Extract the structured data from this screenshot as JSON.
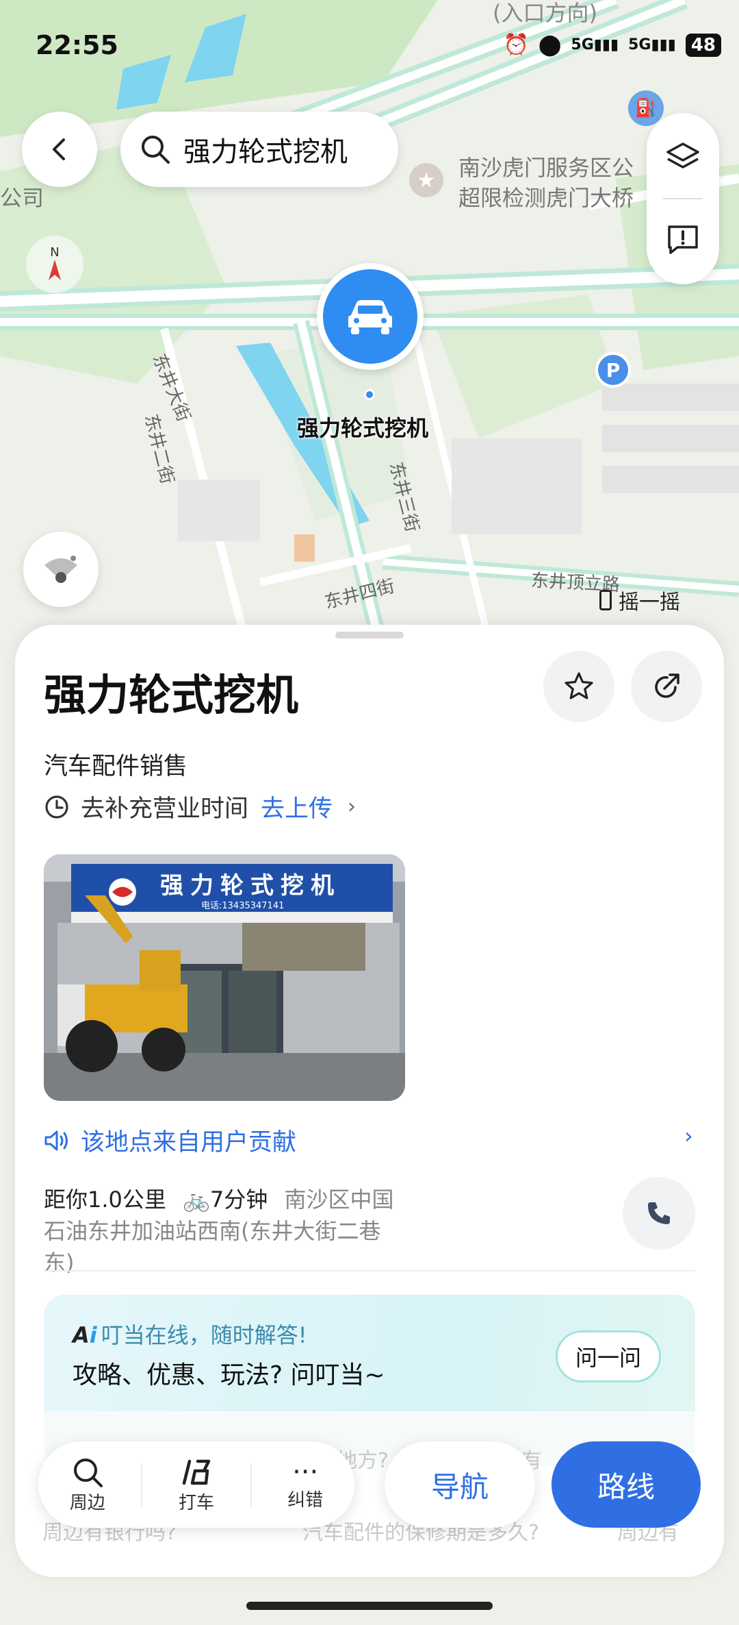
{
  "status_bar": {
    "time": "22:55",
    "battery": "48",
    "signal_1": "5G",
    "signal_2": "5G"
  },
  "search": {
    "query": "强力轮式挖机"
  },
  "map": {
    "labels": {
      "top_entrance": "(入口方向)",
      "service_area_line1": "南沙虎门服务区公",
      "service_area_line2": "超限检测虎门大桥",
      "company": "公司",
      "compass": "N",
      "poi_label": "强力轮式挖机",
      "parking": "P",
      "street_1": "东井大街",
      "street_2": "东井二街",
      "street_3": "东井三街",
      "street_4": "东井四街",
      "road": "东井顶立路",
      "shake": "摇一摇"
    }
  },
  "place": {
    "name": "强力轮式挖机",
    "category": "汽车配件销售",
    "hours_text": "去补充营业时间",
    "upload_text": "去上传",
    "photo_sign": "强力轮式挖机",
    "photo_phone": "电话:13435347141",
    "contribution": "该地点来自用户贡献",
    "distance": "距你1.0公里",
    "ride_time": "7分钟",
    "address": "南沙区中国石油东井加油站西南(东井大街二巷东)"
  },
  "ai": {
    "subtitle": "叮当在线，随时解答!",
    "main": "攻略、优惠、玩法? 问叮当~",
    "ask_button": "问一问",
    "ghost_q1": "地方?",
    "ghost_q2": "有",
    "ghost_q3": "周边有银行吗?",
    "ghost_q4": "汽车配件的保修期是多久?",
    "ghost_q5": "周边有"
  },
  "bottom": {
    "nearby": "周边",
    "taxi": "打车",
    "more": "纠错",
    "navigate": "导航",
    "route": "路线"
  },
  "colors": {
    "accent": "#2f6fe3",
    "road": "#bfe8d7",
    "map_bg": "#eef0ea",
    "water": "#7fd4ef"
  }
}
